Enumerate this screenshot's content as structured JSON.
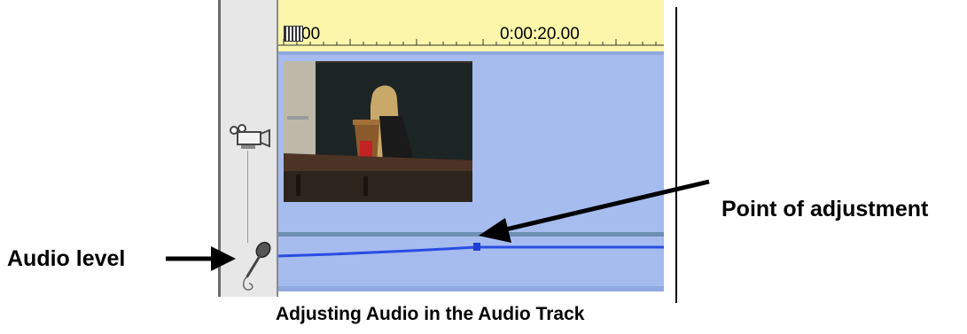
{
  "ruler": {
    "start_label": "00",
    "mark_label": "0:00:20.00"
  },
  "icons": {
    "video_track": "video-camera-icon",
    "audio_track": "microphone-icon",
    "scrubber": "playhead-grip-icon"
  },
  "labels": {
    "audio_level": "Audio level",
    "point_of_adjustment": "Point of adjustment"
  },
  "caption": "Adjusting Audio in the Audio Track",
  "colors": {
    "ruler": "#fbf6a9",
    "track": "#a6bcee",
    "audio_line": "#2b4de3",
    "icon_strip": "#e7e7e7"
  }
}
